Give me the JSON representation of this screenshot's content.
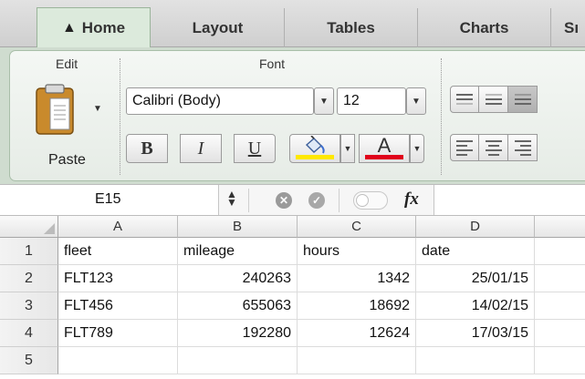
{
  "tabs": [
    {
      "label": "Home",
      "active": true,
      "icon": "home-icon"
    },
    {
      "label": "Layout",
      "active": false
    },
    {
      "label": "Tables",
      "active": false
    },
    {
      "label": "Charts",
      "active": false
    },
    {
      "label": "Sı",
      "active": false
    }
  ],
  "ribbon": {
    "edit_group": {
      "label": "Edit",
      "paste_label": "Paste"
    },
    "font_group": {
      "label": "Font",
      "font_name": "Calibri (Body)",
      "font_size": "12",
      "bold_label": "B",
      "italic_label": "I",
      "underline_label": "U",
      "font_color_label": "A",
      "highlight_color": "#ffe800",
      "font_color": "#e0001b"
    }
  },
  "formula_bar": {
    "name_box": "E15",
    "fx_label": "fx",
    "formula": ""
  },
  "sheet": {
    "columns": [
      "A",
      "B",
      "C",
      "D"
    ],
    "rows": [
      {
        "num": "1",
        "cells": [
          "fleet",
          "mileage",
          "hours",
          "date"
        ]
      },
      {
        "num": "2",
        "cells": [
          "FLT123",
          "240263",
          "1342",
          "25/01/15"
        ]
      },
      {
        "num": "3",
        "cells": [
          "FLT456",
          "655063",
          "18692",
          "14/02/15"
        ]
      },
      {
        "num": "4",
        "cells": [
          "FLT789",
          "192280",
          "12624",
          "17/03/15"
        ]
      },
      {
        "num": "5",
        "cells": [
          "",
          "",
          "",
          ""
        ]
      }
    ]
  }
}
